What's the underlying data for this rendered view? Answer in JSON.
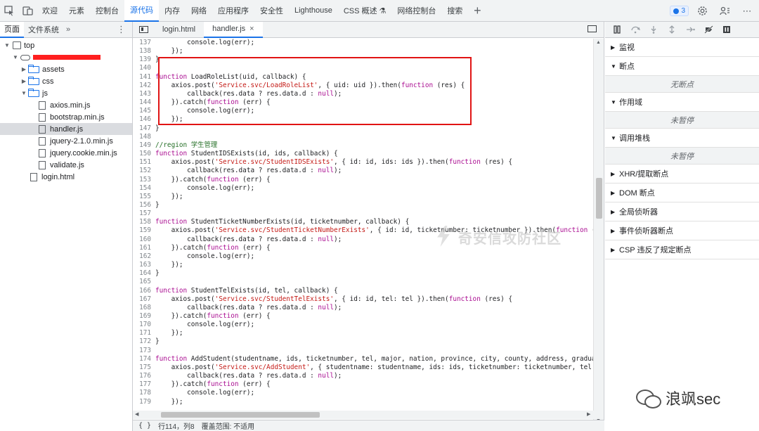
{
  "topbar": {
    "tabs": [
      "欢迎",
      "元素",
      "控制台",
      "源代码",
      "内存",
      "网络",
      "应用程序",
      "安全性",
      "Lighthouse",
      "CSS 概述 ⚗",
      "网络控制台",
      "搜索"
    ],
    "active_tab": "源代码",
    "issues_count": "3"
  },
  "navigator": {
    "tabs": [
      "页面",
      "文件系统"
    ],
    "more": "»",
    "menu": "⋮",
    "tree": [
      {
        "label": "top",
        "indent": 0,
        "arrow": "▼",
        "icon": "frame"
      },
      {
        "label": "",
        "indent": 1,
        "arrow": "▼",
        "icon": "cloud",
        "redacted": true
      },
      {
        "label": "assets",
        "indent": 2,
        "arrow": "▶",
        "icon": "folder"
      },
      {
        "label": "css",
        "indent": 2,
        "arrow": "▶",
        "icon": "folder"
      },
      {
        "label": "js",
        "indent": 2,
        "arrow": "▼",
        "icon": "folder"
      },
      {
        "label": "axios.min.js",
        "indent": 3,
        "arrow": "",
        "icon": "file"
      },
      {
        "label": "bootstrap.min.js",
        "indent": 3,
        "arrow": "",
        "icon": "file"
      },
      {
        "label": "handler.js",
        "indent": 3,
        "arrow": "",
        "icon": "file",
        "selected": true
      },
      {
        "label": "jquery-2.1.0.min.js",
        "indent": 3,
        "arrow": "",
        "icon": "file"
      },
      {
        "label": "jquery.cookie.min.js",
        "indent": 3,
        "arrow": "",
        "icon": "file"
      },
      {
        "label": "validate.js",
        "indent": 3,
        "arrow": "",
        "icon": "file"
      },
      {
        "label": "login.html",
        "indent": 2,
        "arrow": "",
        "icon": "file"
      }
    ]
  },
  "editor": {
    "tabs": [
      {
        "label": "login.html",
        "active": false
      },
      {
        "label": "handler.js",
        "active": true,
        "close": "×"
      }
    ],
    "lines": [
      {
        "n": "137",
        "tokens": [
          [
            "",
            "        console.log(err);"
          ]
        ]
      },
      {
        "n": "138",
        "tokens": [
          [
            "",
            "    });"
          ]
        ]
      },
      {
        "n": "139",
        "tokens": [
          [
            "",
            "}"
          ]
        ]
      },
      {
        "n": "140",
        "tokens": [
          [
            "",
            ""
          ]
        ]
      },
      {
        "n": "141",
        "tokens": [
          [
            "kw",
            "function"
          ],
          [
            "",
            " LoadRoleList(uid, callback) {"
          ]
        ]
      },
      {
        "n": "142",
        "tokens": [
          [
            "",
            "    axios.post("
          ],
          [
            "str",
            "'Service.svc/LoadRoleList'"
          ],
          [
            "",
            ", { uid: uid }).then("
          ],
          [
            "kw",
            "function"
          ],
          [
            "",
            " (res) {"
          ]
        ]
      },
      {
        "n": "143",
        "tokens": [
          [
            "",
            "        callback(res.data ? res.data.d : "
          ],
          [
            "kw",
            "null"
          ],
          [
            "",
            ");"
          ]
        ]
      },
      {
        "n": "144",
        "tokens": [
          [
            "",
            "    }).catch("
          ],
          [
            "kw",
            "function"
          ],
          [
            "",
            " (err) {"
          ]
        ]
      },
      {
        "n": "145",
        "tokens": [
          [
            "",
            "        console.log(err);"
          ]
        ]
      },
      {
        "n": "146",
        "tokens": [
          [
            "",
            "    });"
          ]
        ]
      },
      {
        "n": "147",
        "tokens": [
          [
            "",
            "}"
          ]
        ]
      },
      {
        "n": "148",
        "tokens": [
          [
            "",
            ""
          ]
        ]
      },
      {
        "n": "149",
        "tokens": [
          [
            "cm",
            "//region 学生管理"
          ]
        ]
      },
      {
        "n": "150",
        "tokens": [
          [
            "kw",
            "function"
          ],
          [
            "",
            " StudentIDSExists(id, ids, callback) {"
          ]
        ]
      },
      {
        "n": "151",
        "tokens": [
          [
            "",
            "    axios.post("
          ],
          [
            "str",
            "'Service.svc/StudentIDSExists'"
          ],
          [
            "",
            ", { id: id, ids: ids }).then("
          ],
          [
            "kw",
            "function"
          ],
          [
            "",
            " (res) {"
          ]
        ]
      },
      {
        "n": "152",
        "tokens": [
          [
            "",
            "        callback(res.data ? res.data.d : "
          ],
          [
            "kw",
            "null"
          ],
          [
            "",
            ");"
          ]
        ]
      },
      {
        "n": "153",
        "tokens": [
          [
            "",
            "    }).catch("
          ],
          [
            "kw",
            "function"
          ],
          [
            "",
            " (err) {"
          ]
        ]
      },
      {
        "n": "154",
        "tokens": [
          [
            "",
            "        console.log(err);"
          ]
        ]
      },
      {
        "n": "155",
        "tokens": [
          [
            "",
            "    });"
          ]
        ]
      },
      {
        "n": "156",
        "tokens": [
          [
            "",
            "}"
          ]
        ]
      },
      {
        "n": "157",
        "tokens": [
          [
            "",
            ""
          ]
        ]
      },
      {
        "n": "158",
        "tokens": [
          [
            "kw",
            "function"
          ],
          [
            "",
            " StudentTicketNumberExists(id, ticketnumber, callback) {"
          ]
        ]
      },
      {
        "n": "159",
        "tokens": [
          [
            "",
            "    axios.post("
          ],
          [
            "str",
            "'Service.svc/StudentTicketNumberExists'"
          ],
          [
            "",
            ", { id: id, ticketnumber: ticketnumber }).then("
          ],
          [
            "kw",
            "function"
          ],
          [
            "",
            " ("
          ]
        ]
      },
      {
        "n": "160",
        "tokens": [
          [
            "",
            "        callback(res.data ? res.data.d : "
          ],
          [
            "kw",
            "null"
          ],
          [
            "",
            ");"
          ]
        ]
      },
      {
        "n": "161",
        "tokens": [
          [
            "",
            "    }).catch("
          ],
          [
            "kw",
            "function"
          ],
          [
            "",
            " (err) {"
          ]
        ]
      },
      {
        "n": "162",
        "tokens": [
          [
            "",
            "        console.log(err);"
          ]
        ]
      },
      {
        "n": "163",
        "tokens": [
          [
            "",
            "    });"
          ]
        ]
      },
      {
        "n": "164",
        "tokens": [
          [
            "",
            "}"
          ]
        ]
      },
      {
        "n": "165",
        "tokens": [
          [
            "",
            ""
          ]
        ]
      },
      {
        "n": "166",
        "tokens": [
          [
            "kw",
            "function"
          ],
          [
            "",
            " StudentTelExists(id, tel, callback) {"
          ]
        ]
      },
      {
        "n": "167",
        "tokens": [
          [
            "",
            "    axios.post("
          ],
          [
            "str",
            "'Service.svc/StudentTelExists'"
          ],
          [
            "",
            ", { id: id, tel: tel }).then("
          ],
          [
            "kw",
            "function"
          ],
          [
            "",
            " (res) {"
          ]
        ]
      },
      {
        "n": "168",
        "tokens": [
          [
            "",
            "        callback(res.data ? res.data.d : "
          ],
          [
            "kw",
            "null"
          ],
          [
            "",
            ");"
          ]
        ]
      },
      {
        "n": "169",
        "tokens": [
          [
            "",
            "    }).catch("
          ],
          [
            "kw",
            "function"
          ],
          [
            "",
            " (err) {"
          ]
        ]
      },
      {
        "n": "170",
        "tokens": [
          [
            "",
            "        console.log(err);"
          ]
        ]
      },
      {
        "n": "171",
        "tokens": [
          [
            "",
            "    });"
          ]
        ]
      },
      {
        "n": "172",
        "tokens": [
          [
            "",
            "}"
          ]
        ]
      },
      {
        "n": "173",
        "tokens": [
          [
            "",
            ""
          ]
        ]
      },
      {
        "n": "174",
        "tokens": [
          [
            "kw",
            "function"
          ],
          [
            "",
            " AddStudent(studentname, ids, ticketnumber, tel, major, nation, province, city, county, address, gradua"
          ]
        ]
      },
      {
        "n": "175",
        "tokens": [
          [
            "",
            "    axios.post("
          ],
          [
            "str",
            "'Service.svc/AddStudent'"
          ],
          [
            "",
            ", { studentname: studentname, ids: ids, ticketnumber: ticketnumber, tel:"
          ]
        ]
      },
      {
        "n": "176",
        "tokens": [
          [
            "",
            "        callback(res.data ? res.data.d : "
          ],
          [
            "kw",
            "null"
          ],
          [
            "",
            ");"
          ]
        ]
      },
      {
        "n": "177",
        "tokens": [
          [
            "",
            "    }).catch("
          ],
          [
            "kw",
            "function"
          ],
          [
            "",
            " (err) {"
          ]
        ]
      },
      {
        "n": "178",
        "tokens": [
          [
            "",
            "        console.log(err);"
          ]
        ]
      },
      {
        "n": "179",
        "tokens": [
          [
            "",
            "    });"
          ]
        ]
      }
    ],
    "status": {
      "braces": "{ }",
      "position": "行114，列8",
      "coverage": "覆盖范围: 不适用"
    },
    "watermark": "奇安信攻防社区"
  },
  "debugger": {
    "sections": [
      {
        "label": "监视",
        "arrow": "▶"
      },
      {
        "label": "断点",
        "arrow": "▼",
        "empty": "无断点"
      },
      {
        "label": "作用域",
        "arrow": "▼",
        "empty": "未暂停"
      },
      {
        "label": "调用堆栈",
        "arrow": "▼",
        "empty": "未暂停"
      },
      {
        "label": "XHR/提取断点",
        "arrow": "▶"
      },
      {
        "label": "DOM 断点",
        "arrow": "▶"
      },
      {
        "label": "全局侦听器",
        "arrow": "▶"
      },
      {
        "label": "事件侦听器断点",
        "arrow": "▶"
      },
      {
        "label": "CSP 违反了规定断点",
        "arrow": "▶"
      }
    ]
  },
  "footer_watermark": "浪飒sec"
}
